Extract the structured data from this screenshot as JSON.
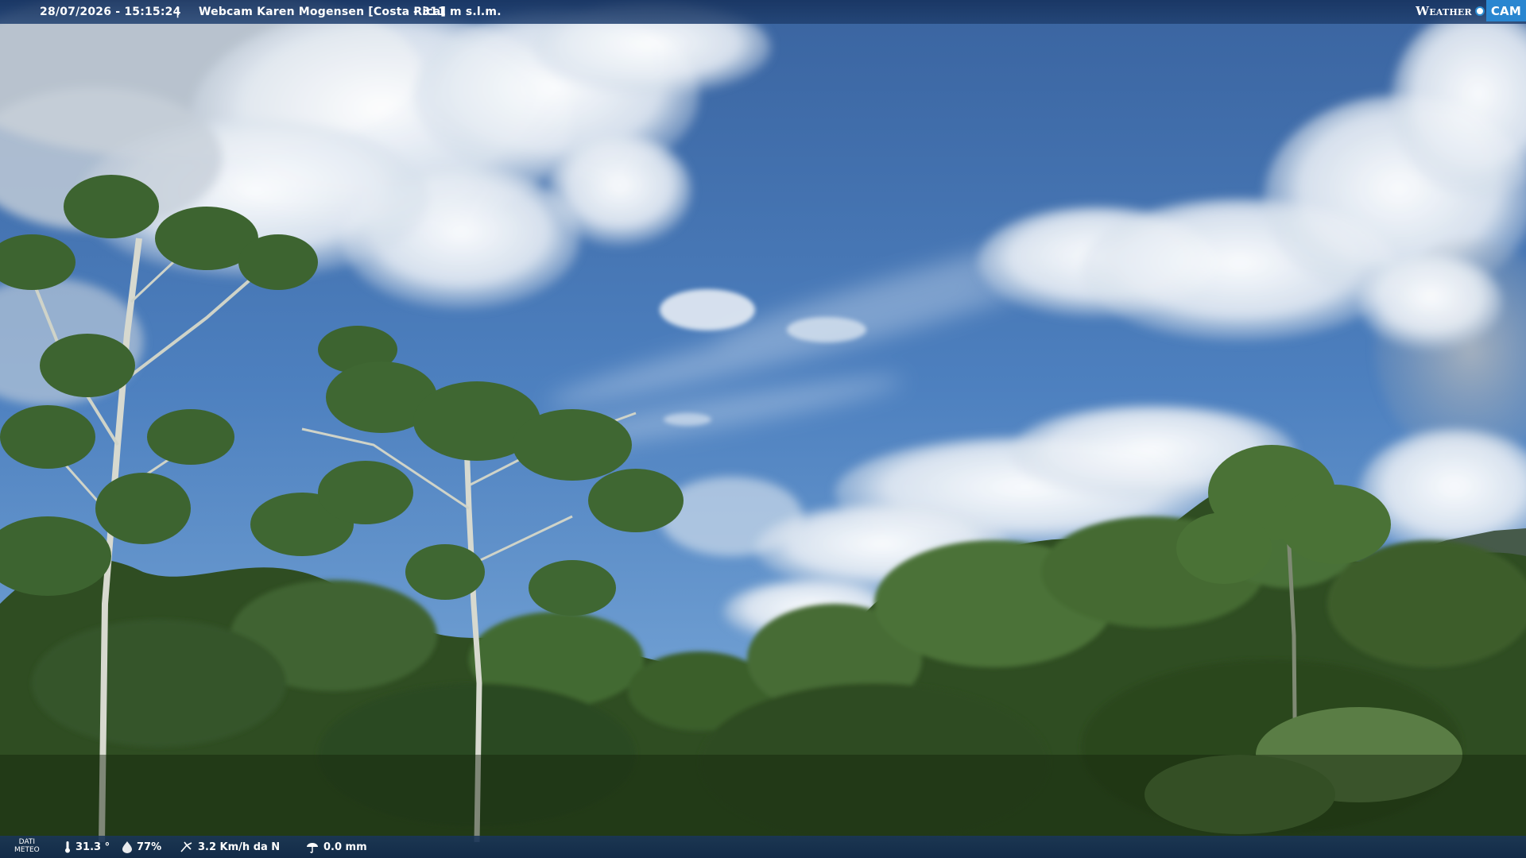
{
  "header": {
    "timestamp": "28/07/2026 - 15:15:24",
    "divider": "|",
    "webcam_title": "Webcam Karen Mogensen [Costa Rica]",
    "altitude": "- 311 m s.l.m."
  },
  "logo": {
    "weather_text": "Weather",
    "cam_text": "CAM"
  },
  "weather_bar": {
    "label_line1": "DATI",
    "label_line2": "METEO",
    "temperature": "31.3 °",
    "humidity": "77%",
    "wind": "3.2 Km/h da N",
    "rain": "0.0 mm"
  },
  "icons": {
    "temperature": "thermometer-icon",
    "humidity": "droplet-icon",
    "wind": "wind-icon",
    "rain": "rain-gauge-icon"
  },
  "colors": {
    "sky_top": "#3c6aa8",
    "sky_bottom": "#5d8fc8",
    "foliage": "#2c4a1e",
    "brand_accent": "#2a86d0"
  }
}
